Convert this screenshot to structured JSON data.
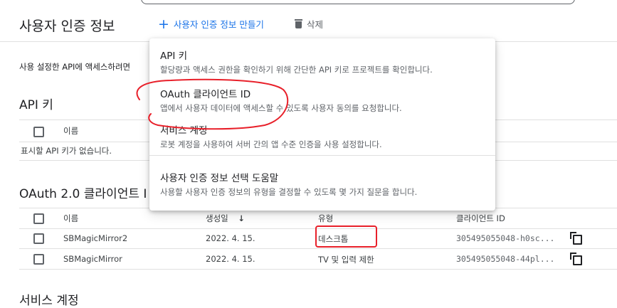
{
  "header": {
    "title": "사용자 인증 정보",
    "create_label": "사용자 인증 정보 만들기",
    "delete_label": "삭제"
  },
  "description": "사용 설정한 API에 액세스하려면",
  "api_keys": {
    "title": "API 키",
    "col_name": "이름",
    "empty": "표시할 API 키가 없습니다."
  },
  "oauth": {
    "title": "OAuth 2.0 클라이언트 I",
    "cols": [
      "이름",
      "생성일",
      "유형",
      "클라이언트 ID"
    ],
    "rows": [
      {
        "name": "SBMagicMirror2",
        "date": "2022. 4. 15.",
        "type": "데스크톱",
        "client_id": "305495055048-h0sc..."
      },
      {
        "name": "SBMagicMirror",
        "date": "2022. 4. 15.",
        "type": "TV 및 입력 제한",
        "client_id": "305495055048-44pl..."
      }
    ]
  },
  "service_accounts": {
    "title": "서비스 계정"
  },
  "menu": {
    "items": [
      {
        "title": "API 키",
        "sub": "할당량과 액세스 권한을 확인하기 위해 간단한 API 키로 프로젝트를 확인합니다."
      },
      {
        "title": "OAuth 클라이언트 ID",
        "sub": "앱에서 사용자 데이터에 액세스할 수 있도록 사용자 동의를 요청합니다."
      },
      {
        "title": "서비스 계정",
        "sub": "로봇 계정을 사용하여 서버 간의 앱 수준 인증을 사용 설정합니다."
      },
      {
        "title": "사용자 인증 정보 선택 도움말",
        "sub": "사용할 사용자 인증 정보의 유형을 결정할 수 있도록 몇 가지 질문을 합니다."
      }
    ]
  },
  "colors": {
    "accent": "#1a73e8",
    "annotation": "#e8202a"
  }
}
